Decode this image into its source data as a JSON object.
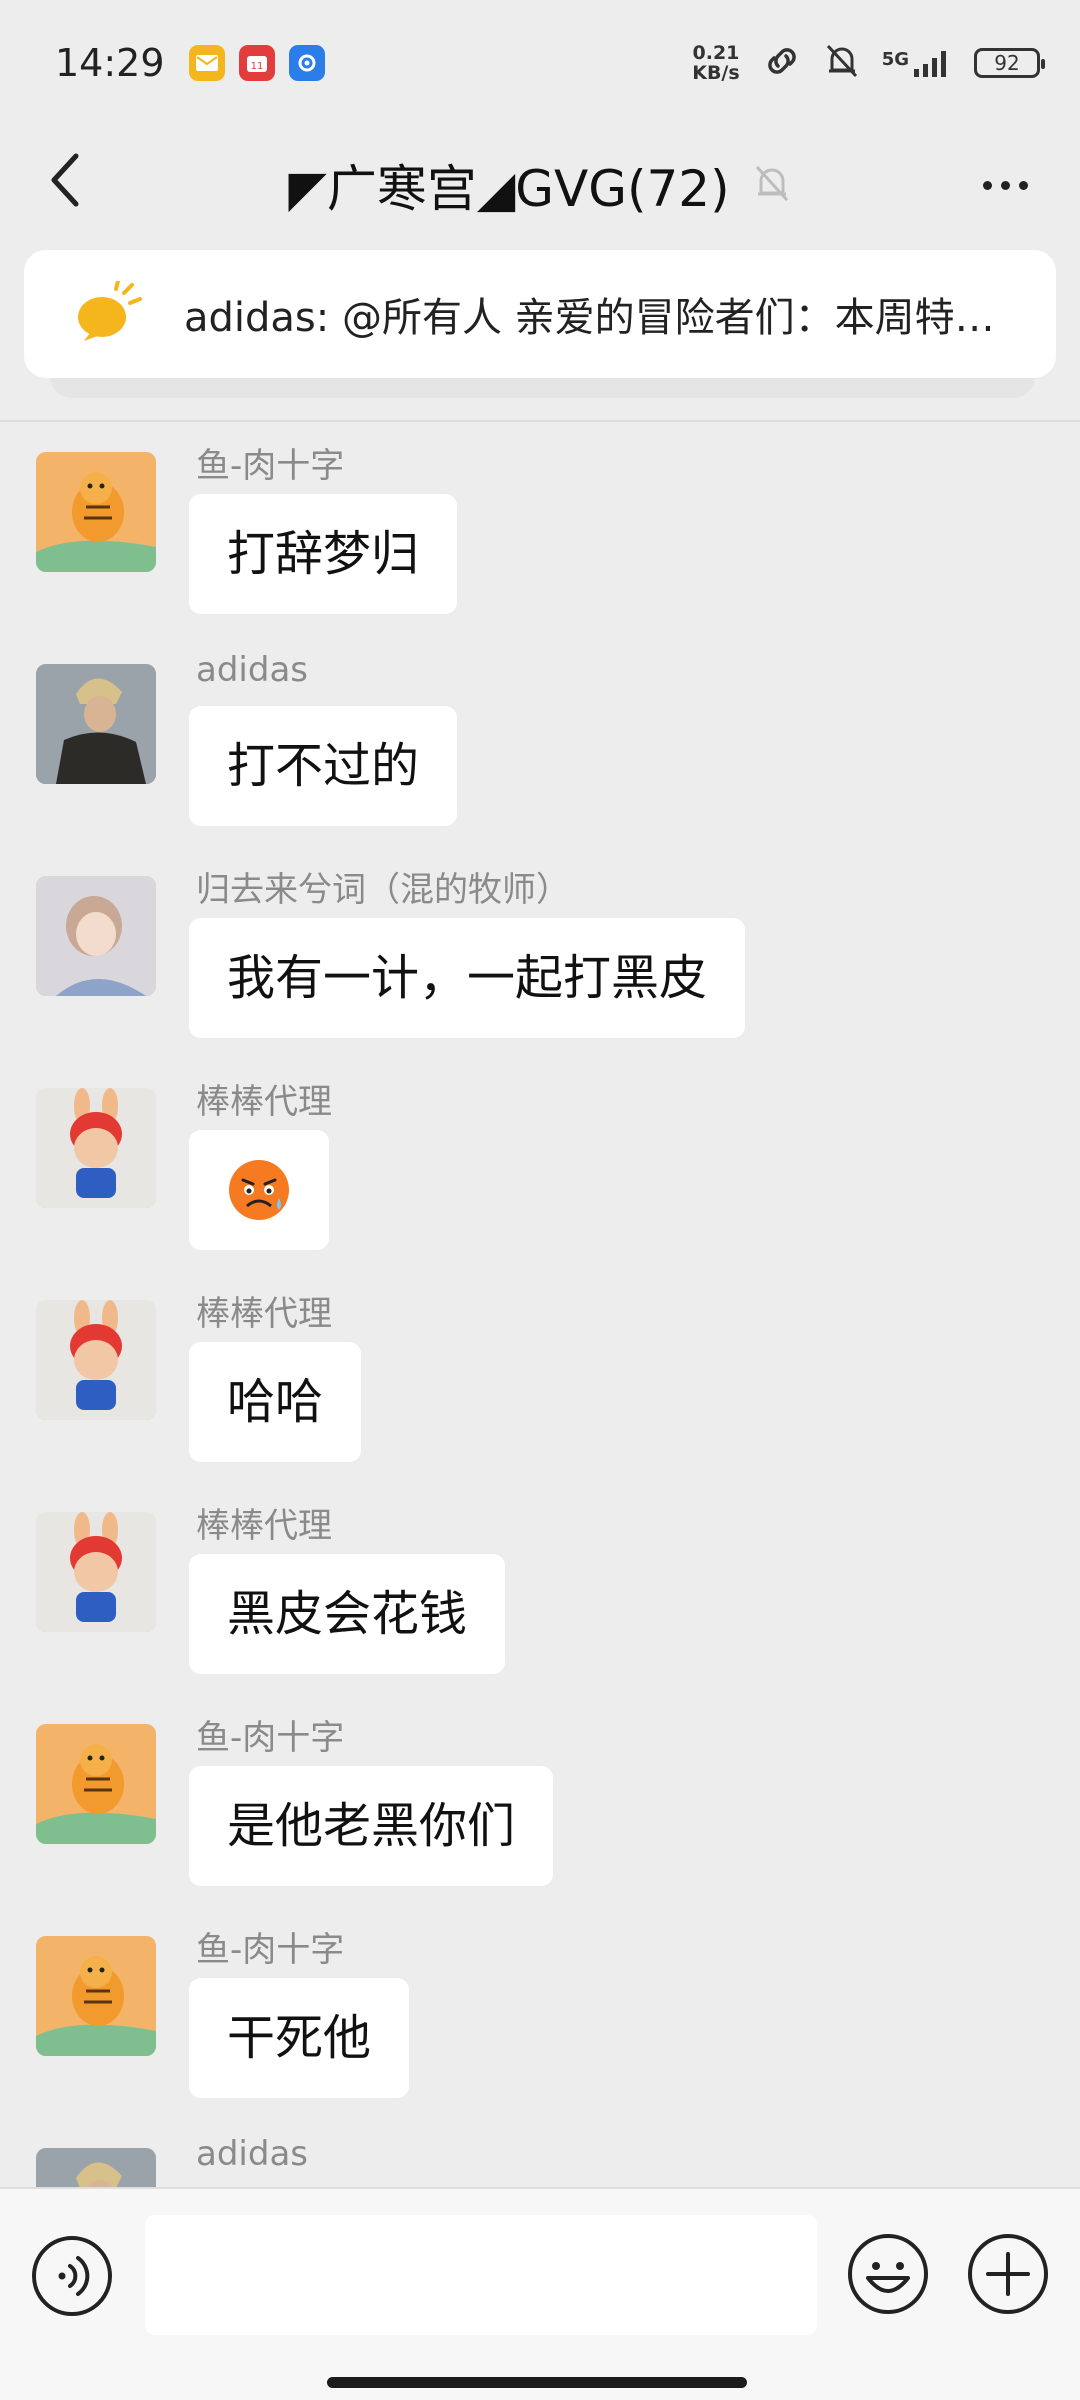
{
  "status_bar": {
    "time": "14:29",
    "net_speed_value": "0.21",
    "net_speed_unit": "KB/s",
    "network": "5G",
    "battery": "92"
  },
  "header": {
    "title": "◤广寒宫◢GVG(72)"
  },
  "announcement": {
    "text": "adidas: @所有人 亲爱的冒险者们：本周特…"
  },
  "messages": [
    {
      "sender": "鱼-肉十字",
      "text": "打辞梦归",
      "avatar": "tiger"
    },
    {
      "sender": "adidas",
      "text": "打不过的",
      "avatar": "soldier"
    },
    {
      "sender": "归去来兮词（混的牧师）",
      "text": "我有一计，一起打黑皮",
      "avatar": "anime"
    },
    {
      "sender": "棒棒代理",
      "text": "",
      "emoji": "sweat-angry-face",
      "avatar": "mario"
    },
    {
      "sender": "棒棒代理",
      "text": "哈哈",
      "avatar": "mario"
    },
    {
      "sender": "棒棒代理",
      "text": "黑皮会花钱",
      "avatar": "mario"
    },
    {
      "sender": "鱼-肉十字",
      "text": "是他老黑你们",
      "avatar": "tiger"
    },
    {
      "sender": "鱼-肉十字",
      "text": "干死他",
      "avatar": "tiger"
    },
    {
      "sender": "adidas",
      "text": "",
      "avatar": "soldier"
    }
  ],
  "input": {
    "value": ""
  },
  "colors": {
    "background": "#ededed",
    "bubble": "#ffffff",
    "sender_name": "#8a8a8a",
    "announcement_icon": "#f5b51c"
  }
}
